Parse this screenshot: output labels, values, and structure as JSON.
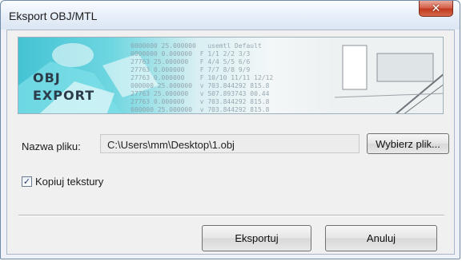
{
  "window": {
    "title": "Eksport OBJ/MTL"
  },
  "banner": {
    "logo_line1": "OBJ",
    "logo_line2": "EXPORT",
    "code_text": "0000000 25.000000   usemtl Default\n0000000 0.000000  F 1/1 2/2 3/3\n27763 25.000000   F 4/4 5/5 6/6\n27763 0.000000    F 7/7 8/8 9/9\n27763 0.000000    F 10/10 11/11 12/12\n000000 25.000000  v 703.844292 815.8\n27763 25.000000   v 507.893743 00.44\n27763 0.000000    v 703.844292 815.8\n000000 25.000000  v 703.844292 815.8"
  },
  "file": {
    "label": "Nazwa pliku:",
    "path": "C:\\Users\\mm\\Desktop\\1.obj",
    "browse_label": "Wybierz plik..."
  },
  "options": {
    "copy_textures_label": "Kopiuj tekstury",
    "copy_textures_checked": true,
    "check_glyph": "✓"
  },
  "actions": {
    "export_label": "Eksportuj",
    "cancel_label": "Anuluj"
  },
  "icons": {
    "close": "close-icon",
    "check": "checkmark-icon"
  }
}
